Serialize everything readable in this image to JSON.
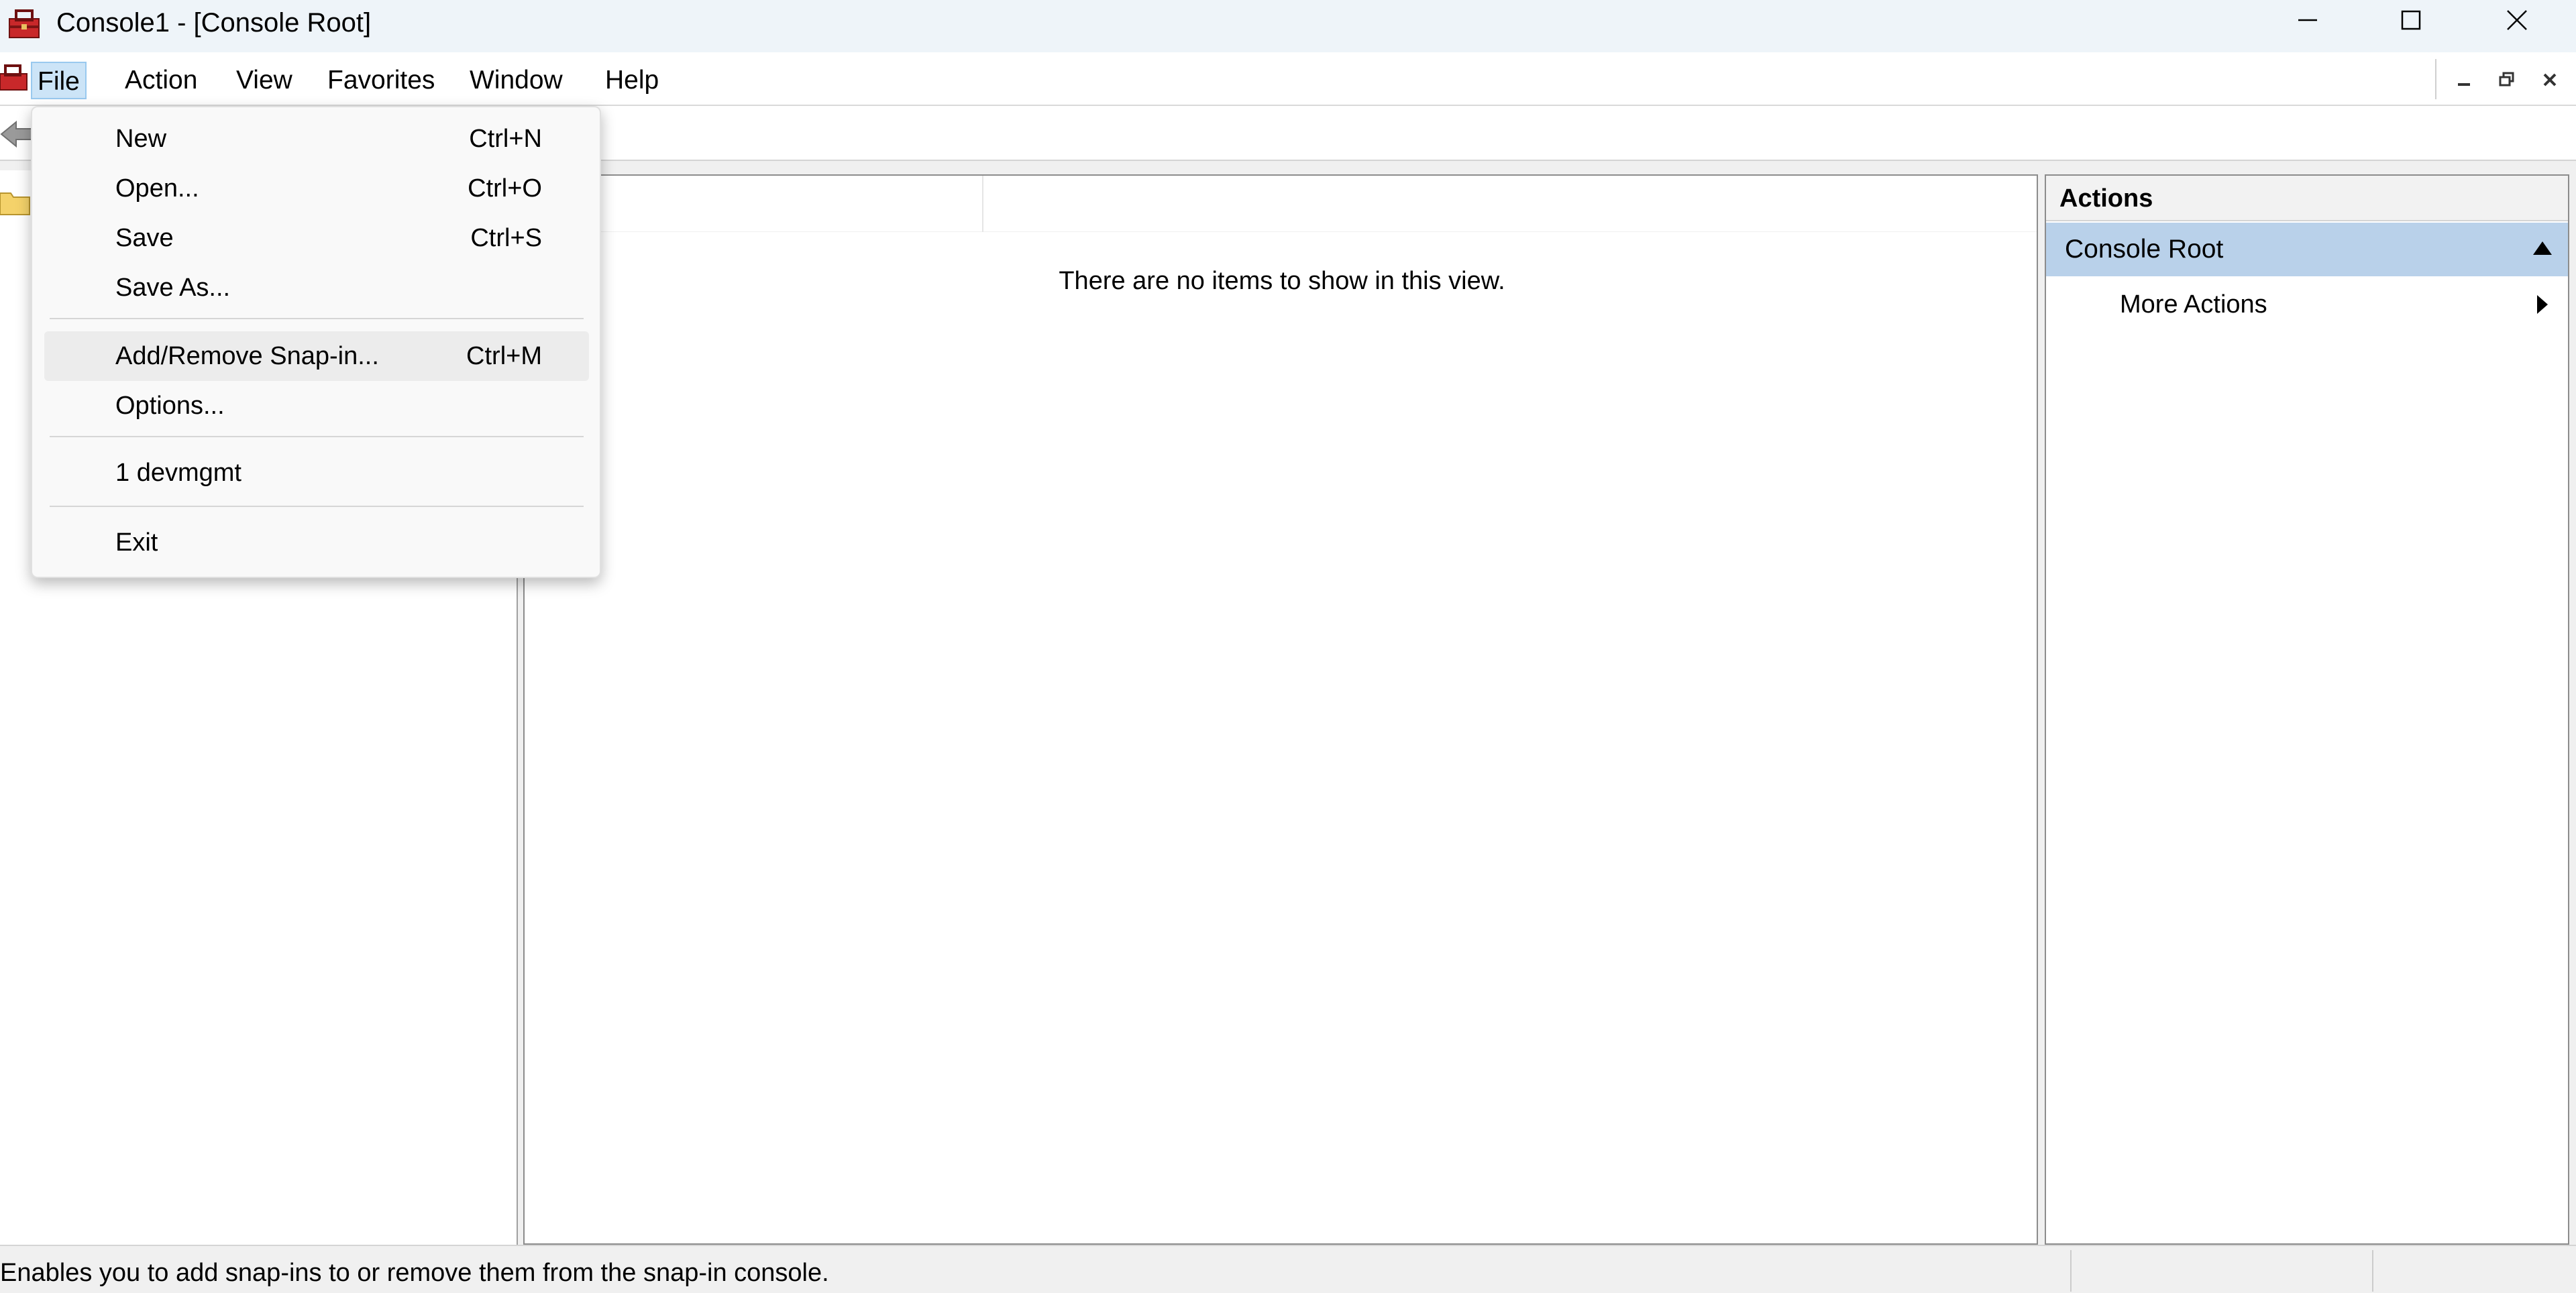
{
  "window": {
    "title": "Console1 - [Console Root]"
  },
  "menubar": {
    "items": [
      "File",
      "Action",
      "View",
      "Favorites",
      "Window",
      "Help"
    ],
    "active": "File"
  },
  "file_menu": {
    "items": [
      {
        "label": "New",
        "shortcut": "Ctrl+N"
      },
      {
        "label": "Open...",
        "shortcut": "Ctrl+O"
      },
      {
        "label": "Save",
        "shortcut": "Ctrl+S"
      },
      {
        "label": "Save As...",
        "shortcut": ""
      },
      {
        "label": "Add/Remove Snap-in...",
        "shortcut": "Ctrl+M"
      },
      {
        "label": "Options...",
        "shortcut": ""
      },
      {
        "label": "1 devmgmt",
        "shortcut": ""
      },
      {
        "label": "Exit",
        "shortcut": ""
      }
    ],
    "highlighted": "Add/Remove Snap-in..."
  },
  "center": {
    "column_header_visible": "e",
    "empty_message": "There are no items to show in this view."
  },
  "actions": {
    "header": "Actions",
    "section": "Console Root",
    "item": "More Actions"
  },
  "statusbar": {
    "text": "Enables you to add snap-ins to or remove them from the snap-in console."
  },
  "icons": {
    "app": "console-toolbox-icon",
    "back": "back-arrow-icon",
    "folder": "folder-icon",
    "minimize": "minimize-icon",
    "maximize": "maximize-icon",
    "close": "close-icon"
  },
  "colors": {
    "titlebar_bg": "#eef4f9",
    "menu_active_bg": "#cce4f7",
    "actions_section_bg": "#b9d1ea"
  }
}
